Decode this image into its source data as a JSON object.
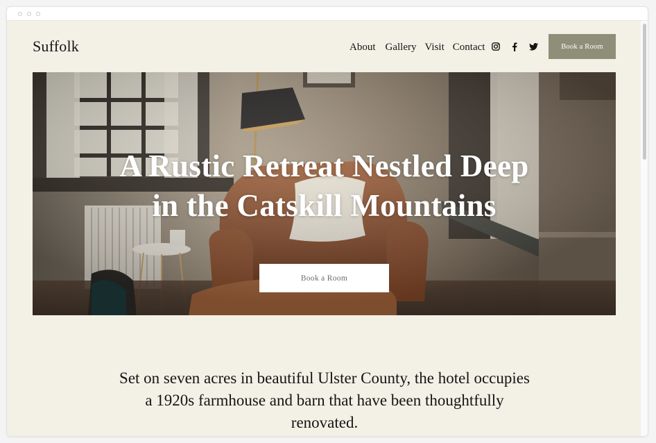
{
  "site": {
    "logo": "Suffolk"
  },
  "nav": {
    "items": [
      {
        "label": "About"
      },
      {
        "label": "Gallery"
      },
      {
        "label": "Visit"
      },
      {
        "label": "Contact"
      }
    ],
    "social_icons": [
      "instagram-icon",
      "facebook-icon",
      "twitter-icon"
    ],
    "book_button": "Book a Room"
  },
  "hero": {
    "title_lines": [
      "A Rustic Retreat Nestled Deep",
      "in the Catskill Mountains"
    ],
    "button": "Book a Room"
  },
  "intro": {
    "lines": [
      "Set on seven acres in beautiful Ulster County, the hotel occupies",
      "a 1920s farmhouse and barn that have been thoughtfully",
      "renovated."
    ]
  },
  "colors": {
    "page_bg": "#f3f0e6",
    "button_bg": "#8f8f79",
    "text": "#151515"
  }
}
